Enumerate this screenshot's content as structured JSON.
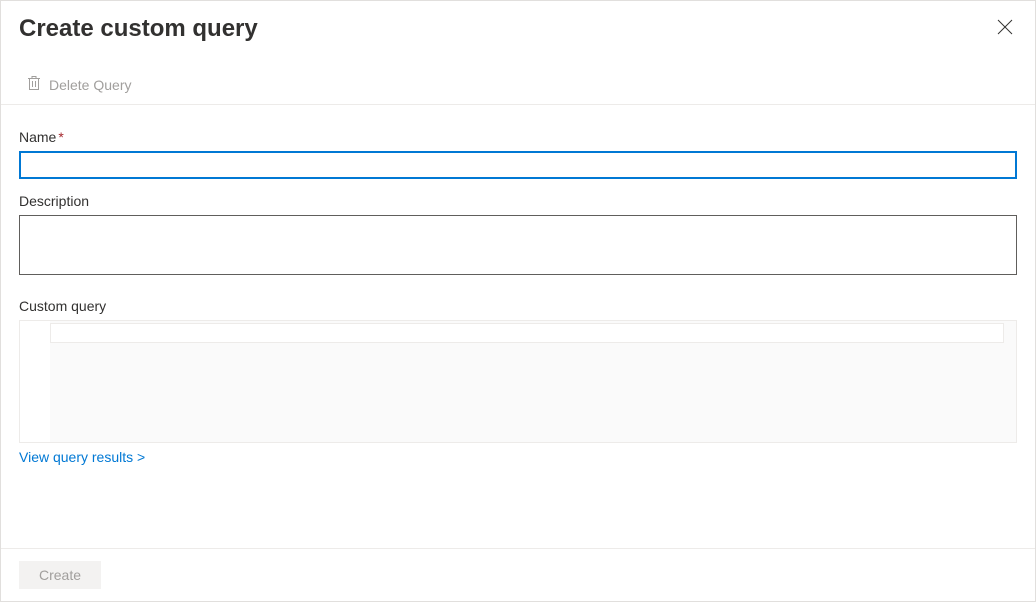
{
  "panel": {
    "title": "Create custom query"
  },
  "commands": {
    "delete_label": "Delete Query"
  },
  "form": {
    "name_label": "Name",
    "name_value": "",
    "description_label": "Description",
    "description_value": "",
    "custom_query_label": "Custom query",
    "view_results_link": "View query results >"
  },
  "footer": {
    "create_label": "Create"
  }
}
